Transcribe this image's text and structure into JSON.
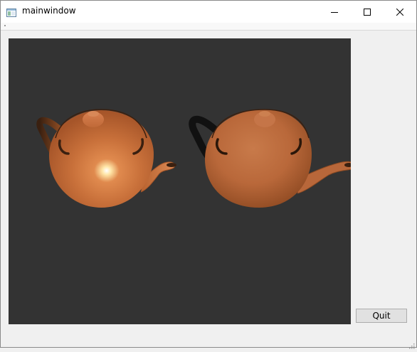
{
  "window": {
    "title": "mainwindow",
    "icon": "app-window-icon",
    "controls": [
      "minimize-icon",
      "maximize-icon",
      "close-icon"
    ]
  },
  "viewport": {
    "background": "#333333",
    "objects": [
      "teapot-left",
      "teapot-right"
    ],
    "teapot_color": "#c46a3a",
    "highlight_color": "#fff4c8"
  },
  "buttons": {
    "quit_label": "Quit"
  }
}
